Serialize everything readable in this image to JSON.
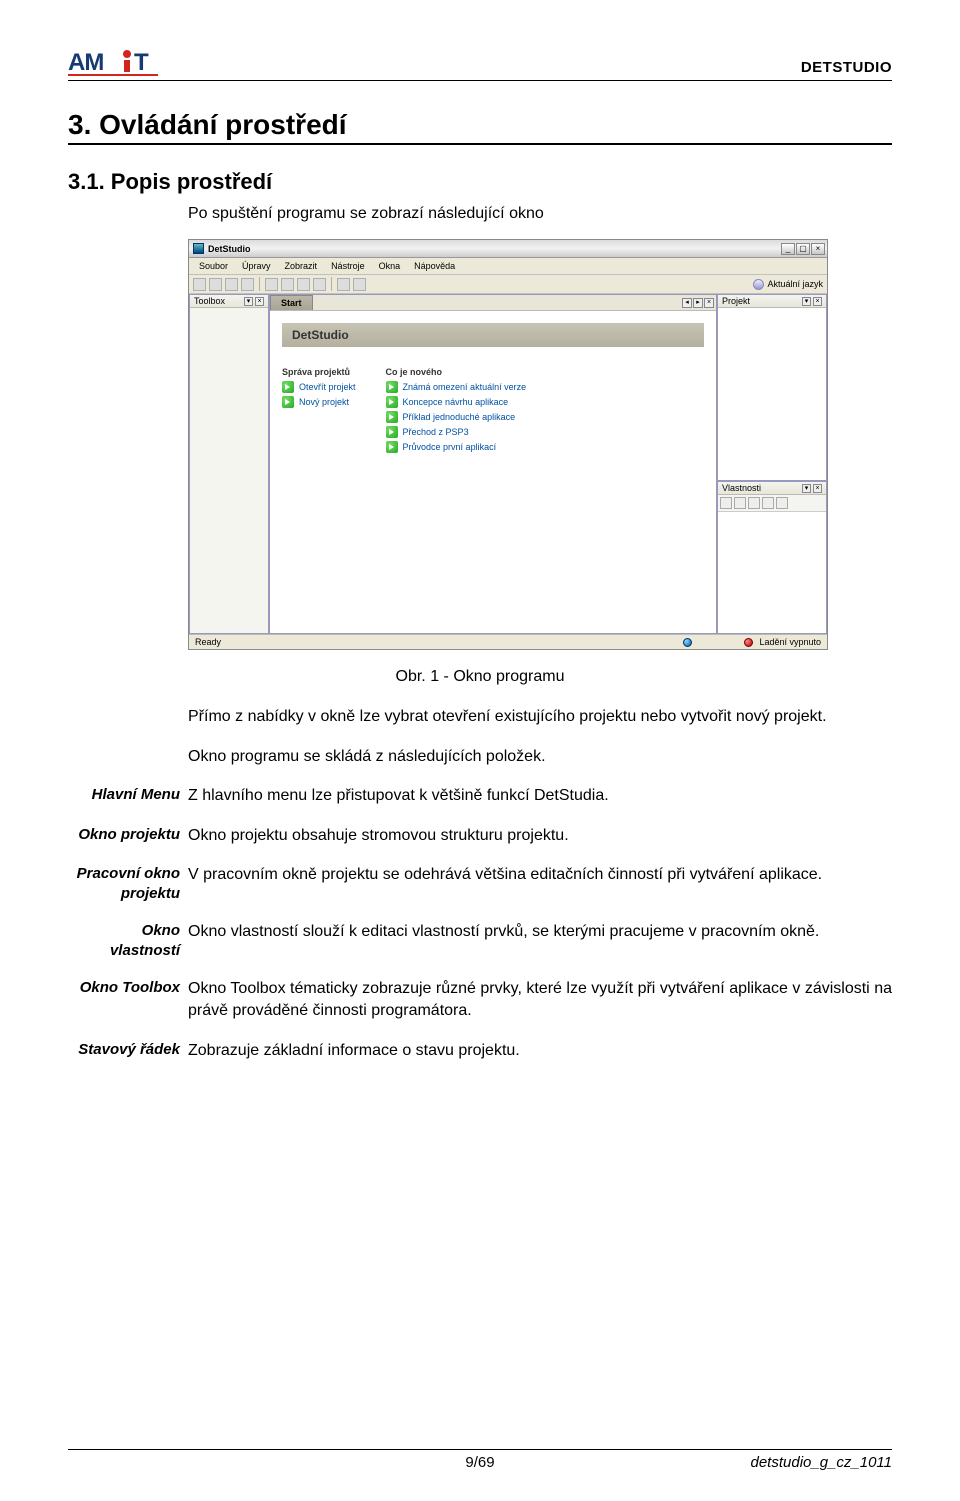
{
  "header": {
    "doc_name": "DETSTUDIO"
  },
  "section": {
    "title": "3.  Ovládání prostředí"
  },
  "subsection": {
    "title": "3.1.  Popis prostředí",
    "intro": "Po spuštění programu se zobrazí následující okno"
  },
  "screenshot": {
    "title": "DetStudio",
    "menubar": [
      "Soubor",
      "Úpravy",
      "Zobrazit",
      "Nástroje",
      "Okna",
      "Nápověda"
    ],
    "lang_label": "Aktuální jazyk",
    "toolbox_title": "Toolbox",
    "start_tab": "Start",
    "brand": "DetStudio",
    "col1_title": "Správa projektů",
    "col1_links": [
      "Otevřít projekt",
      "Nový projekt"
    ],
    "col2_title": "Co je nového",
    "col2_links": [
      "Známá omezení aktuální verze",
      "Koncepce návrhu aplikace",
      "Příklad jednoduché aplikace",
      "Přechod z PSP3",
      "Průvodce první aplikací"
    ],
    "projekt_title": "Projekt",
    "vlastnosti_title": "Vlastnosti",
    "status_left": "Ready",
    "status_right": "Ladění vypnuto"
  },
  "figure_caption": "Obr. 1 -  Okno programu",
  "para1": "Přímo z nabídky v okně lze vybrat otevření existujícího projektu nebo vytvořit nový projekt.",
  "para2": "Okno programu se skládá z následujících položek.",
  "definitions": [
    {
      "term": "Hlavní Menu",
      "body": "Z hlavního menu lze přistupovat k většině funkcí DetStudia."
    },
    {
      "term": "Okno projektu",
      "body": "Okno projektu obsahuje stromovou strukturu projektu."
    },
    {
      "term": "Pracovní okno projektu",
      "body": "V pracovním okně projektu se odehrává většina editačních činností při vytváření aplikace."
    },
    {
      "term": "Okno vlastností",
      "body": "Okno vlastností slouží k editaci vlastností prvků, se kterými pracujeme v pracovním okně."
    },
    {
      "term": "Okno Toolbox",
      "body": "Okno Toolbox tématicky zobrazuje různé prvky, které lze využít při vytváření aplikace  v závislosti na právě prováděné činnosti programátora."
    },
    {
      "term": "Stavový řádek",
      "body": "Zobrazuje základní informace o stavu projektu."
    }
  ],
  "footer": {
    "page": "9/69",
    "doc_id": "detstudio_g_cz_1011"
  }
}
